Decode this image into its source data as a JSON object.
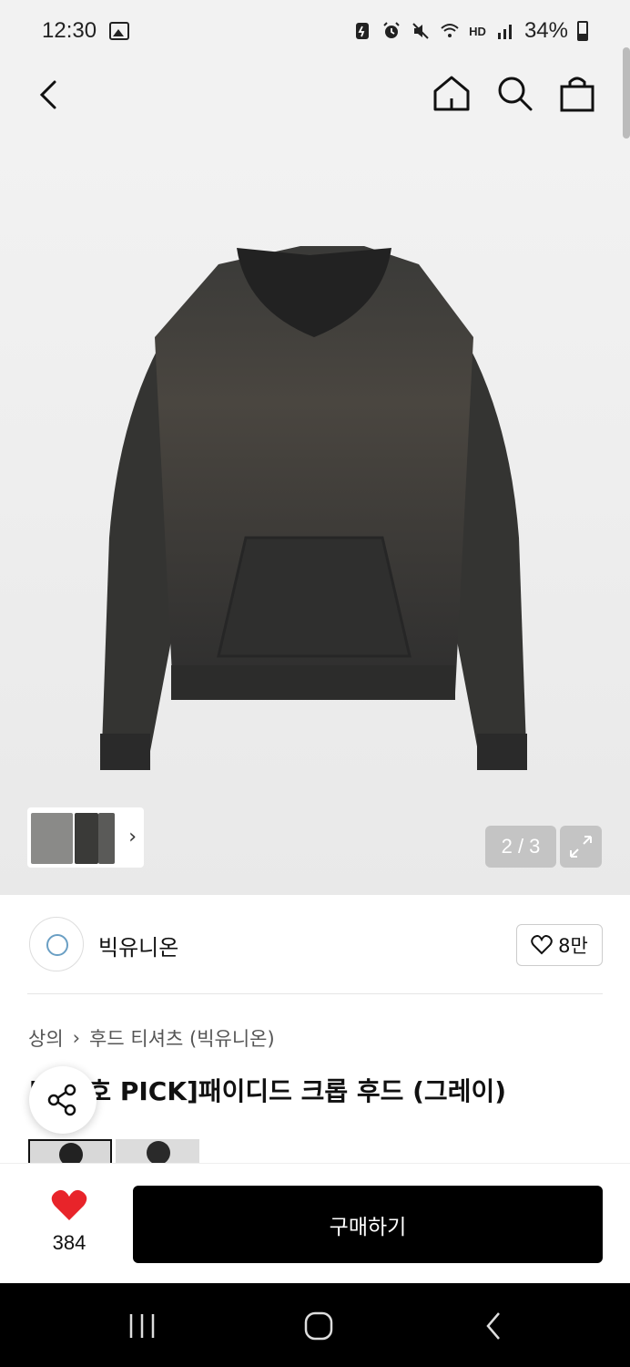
{
  "status": {
    "time": "12:30",
    "battery": "34%",
    "hd_label": "HD"
  },
  "nav": {
    "back": "back-icon",
    "home": "home-icon",
    "search": "search-icon",
    "cart": "shopping-bag-icon"
  },
  "gallery": {
    "counter": "2 / 3",
    "expand": "expand-icon"
  },
  "brand": {
    "name": "빅유니온",
    "likes": "8만"
  },
  "breadcrumb": {
    "category": "상의",
    "subcategory": "후드 티셔츠 (빅유니온)"
  },
  "product": {
    "title": "[이진호 PICK]패이디드 크롭 후드 (그레이)"
  },
  "buybar": {
    "wish_count": "384",
    "buy_label": "구매하기"
  },
  "colors": {
    "accent": "#e8242a",
    "buy_button": "#000000"
  }
}
